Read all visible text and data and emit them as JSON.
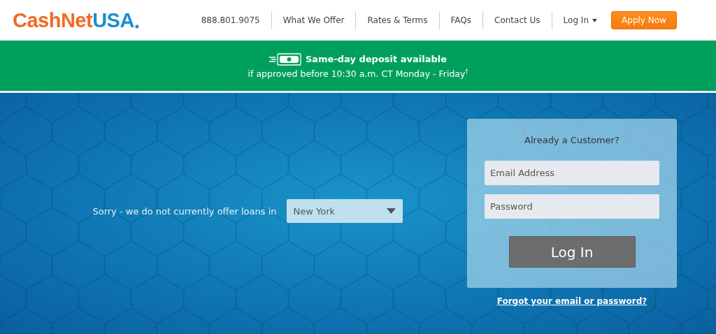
{
  "logo": {
    "part_1": "CashNet",
    "part_2": "USA"
  },
  "nav": {
    "phone": "888.801.9075",
    "links": [
      {
        "label": "What We Offer",
        "kind": "link"
      },
      {
        "label": "Rates & Terms",
        "kind": "link"
      },
      {
        "label": "FAQs",
        "kind": "link"
      },
      {
        "label": "Contact Us",
        "kind": "link"
      },
      {
        "label": "Log In",
        "kind": "dropdown"
      }
    ],
    "cta": "Apply Now"
  },
  "banner": {
    "headline": "Same-day deposit available",
    "subline": "if approved before 10:30 a.m. CT Monday - Friday$^{†}$"
  },
  "state_notice": {
    "text": "Sorry - we do not currently offer loans in",
    "state_select": "New York"
  },
  "login": {
    "title": "Already a Customer?",
    "email_placeholder": "Email Address",
    "password_placeholder": "Password",
    "button": "Log In",
    "forgot_link": "Forgot your email or password?"
  }
}
